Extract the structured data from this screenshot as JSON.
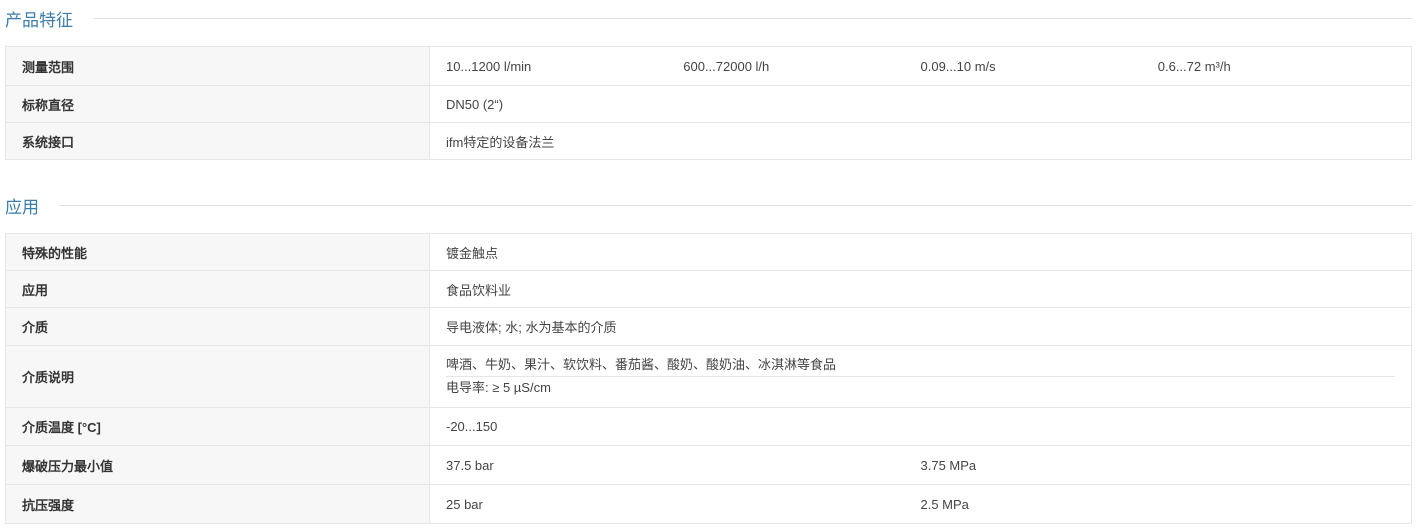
{
  "sections": [
    {
      "title": "产品特征",
      "rows": [
        {
          "label": "测量范围",
          "values": [
            "10...1200 l/min",
            "600...72000 l/h",
            "0.09...10 m/s",
            "0.6...72 m³/h"
          ]
        },
        {
          "label": "标称直径",
          "values": [
            "DN50 (2“)"
          ]
        },
        {
          "label": "系统接口",
          "values": [
            "ifm特定的设备法兰"
          ]
        }
      ]
    },
    {
      "title": "应用",
      "rows": [
        {
          "label": "特殊的性能",
          "values": [
            "镀金触点"
          ]
        },
        {
          "label": "应用",
          "values": [
            "食品饮料业"
          ]
        },
        {
          "label": "介质",
          "values": [
            "导电液体; 水; 水为基本的介质"
          ]
        },
        {
          "label": "介质说明",
          "lines": [
            "啤酒、牛奶、果汁、软饮料、番茄酱、酸奶、酸奶油、冰淇淋等食品",
            "电导率: ≥ 5 µS/cm"
          ]
        },
        {
          "label": "介质温度 [°C]",
          "values": [
            "-20...150"
          ]
        },
        {
          "label": "爆破压力最小值",
          "values": [
            "37.5 bar",
            "3.75 MPa"
          ]
        },
        {
          "label": "抗压强度",
          "values": [
            "25 bar",
            "2.5 MPa"
          ]
        }
      ]
    }
  ]
}
